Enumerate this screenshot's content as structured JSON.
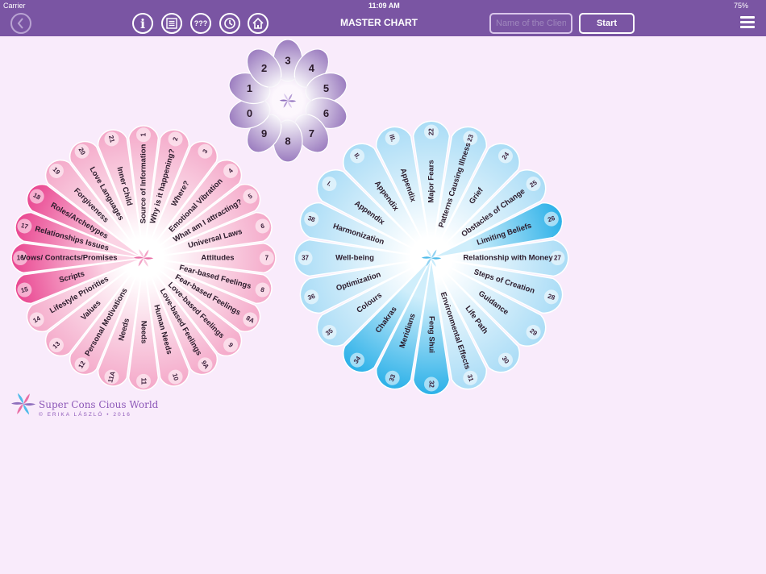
{
  "status_bar": {
    "carrier": "Carrier",
    "time": "11:09 AM",
    "battery": "75%"
  },
  "nav": {
    "title": "MASTER CHART",
    "client_placeholder": "Name of the Client",
    "start_label": "Start",
    "toolbar_icons": [
      "info-icon",
      "list-icon",
      "question-marks-icon",
      "history-clock-icon",
      "home-icon"
    ],
    "info_glyph": "i",
    "question_glyph": "???"
  },
  "colors": {
    "nav": "#7a55a3",
    "background": "#f9ebfb",
    "pink": "#f4a7c8",
    "pink_strong": "#e9438f",
    "blue": "#a9dcf6",
    "blue_strong": "#2ab0e8",
    "purple": "#9b7cbf"
  },
  "number_flower": {
    "petals": [
      "3",
      "4",
      "5",
      "6",
      "7",
      "8",
      "9",
      "0",
      "1",
      "2"
    ]
  },
  "left_wheel": {
    "petals": [
      {
        "label": "Source of Information",
        "num": "1"
      },
      {
        "label": "Why is it happening?",
        "num": "2"
      },
      {
        "label": "Where?",
        "num": "3"
      },
      {
        "label": "Emotional Vibration",
        "num": "4"
      },
      {
        "label": "What am I attracting?",
        "num": "5"
      },
      {
        "label": "Universal Laws",
        "num": "6"
      },
      {
        "label": "Attitudes",
        "num": "7"
      },
      {
        "label": "Fear-based Feelings",
        "num": "8"
      },
      {
        "label": "Fear-based Feelings",
        "num": "8A"
      },
      {
        "label": "Love-based Feelings",
        "num": "9"
      },
      {
        "label": "Love-based Feelings",
        "num": "9A"
      },
      {
        "label": "Human Needs",
        "num": "10"
      },
      {
        "label": "Needs",
        "num": "11"
      },
      {
        "label": "Needs",
        "num": "11A"
      },
      {
        "label": "Personal Motivations",
        "num": "12"
      },
      {
        "label": "Values",
        "num": "13"
      },
      {
        "label": "Lifestyle Priorities",
        "num": "14"
      },
      {
        "label": "Scripts",
        "num": "15"
      },
      {
        "label": "Vows/ Contracts/Promises",
        "num": "16"
      },
      {
        "label": "Relationships Issues",
        "num": "17"
      },
      {
        "label": "Roles/Archetypes",
        "num": "18"
      },
      {
        "label": "Forgiveness",
        "num": "19"
      },
      {
        "label": "Love Languages",
        "num": "20"
      },
      {
        "label": "Inner Child",
        "num": "21"
      }
    ]
  },
  "right_wheel": {
    "petals": [
      {
        "label": "Major Fears",
        "num": "22"
      },
      {
        "label": "Patterns Causing Illness",
        "num": "23"
      },
      {
        "label": "Grief",
        "num": "24"
      },
      {
        "label": "Obstacles of Change",
        "num": "25"
      },
      {
        "label": "Limiting Beliefs",
        "num": "26"
      },
      {
        "label": "Relationship with Money",
        "num": "27"
      },
      {
        "label": "Steps of Creation",
        "num": "28"
      },
      {
        "label": "Guidance",
        "num": "29"
      },
      {
        "label": "Life Path",
        "num": "30"
      },
      {
        "label": "Environmental Effects",
        "num": "31"
      },
      {
        "label": "Feng Shui",
        "num": "32"
      },
      {
        "label": "Meridians",
        "num": "33"
      },
      {
        "label": "Chakras",
        "num": "34"
      },
      {
        "label": "Colours",
        "num": "35"
      },
      {
        "label": "Optimization",
        "num": "36"
      },
      {
        "label": "Well-being",
        "num": "37"
      },
      {
        "label": "Harmonization",
        "num": "38"
      },
      {
        "label": "Appendix",
        "num": "I."
      },
      {
        "label": "Appendix",
        "num": "II."
      },
      {
        "label": "Appendix",
        "num": "III."
      }
    ]
  },
  "branding": {
    "name": "Super Cons Cious World",
    "copyright": "© ERIKA LÁSZLÓ • 2016"
  }
}
